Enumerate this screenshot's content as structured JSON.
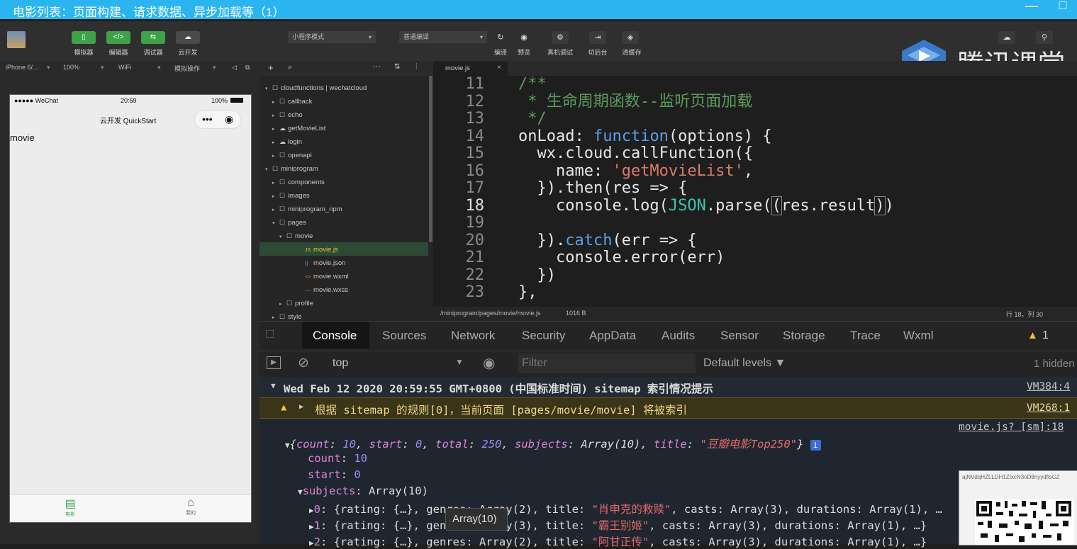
{
  "window": {
    "title": "电影列表：页面构建、请求数据、异步加载等（1）",
    "min_icon": "minimize-icon",
    "max_icon": "maximize-icon"
  },
  "watermark": {
    "text": "腾讯课堂"
  },
  "toolbar": {
    "left_buttons": [
      {
        "label": "模拟器",
        "icon": "phone-icon",
        "color": "#3ea24a"
      },
      {
        "label": "编辑器",
        "icon": "code-icon",
        "color": "#3ea24a"
      },
      {
        "label": "调试器",
        "icon": "debug-icon",
        "color": "#3ea24a"
      },
      {
        "label": "云开发",
        "icon": "cloud-icon",
        "color": "#4a4a4a"
      }
    ],
    "mode_select": "小程序模式",
    "compile_select": "普通编译",
    "right_buttons": [
      {
        "label": "编译",
        "icon": "refresh-icon"
      },
      {
        "label": "预览",
        "icon": "eye-icon"
      },
      {
        "label": "真机调试",
        "icon": "device-debug-icon"
      },
      {
        "label": "切后台",
        "icon": "background-icon"
      },
      {
        "label": "清缓存",
        "icon": "clear-cache-icon"
      }
    ]
  },
  "subbar": {
    "device": "iPhone 6/...",
    "zoom": "100%",
    "network": "WiFi",
    "sim_op": "模拟操作"
  },
  "phone": {
    "status_carrier": "●●●●● WeChat",
    "status_time": "20:59",
    "status_battery": "100%",
    "nav_title": "云开发 QuickStart",
    "body_text": "movie",
    "tabs": [
      {
        "label": "电影",
        "icon": "film-icon",
        "active": true
      },
      {
        "label": "我的",
        "icon": "home-icon",
        "active": false
      }
    ]
  },
  "tree": {
    "items": [
      {
        "label": "cloudfunctions | wechatcloud",
        "arrow": "▾",
        "icon": "folder",
        "depth": 0
      },
      {
        "label": "callback",
        "arrow": "▸",
        "icon": "folder",
        "depth": 1
      },
      {
        "label": "echo",
        "arrow": "▸",
        "icon": "folder",
        "depth": 1
      },
      {
        "label": "getMovieList",
        "arrow": "▸",
        "icon": "cloud",
        "depth": 1
      },
      {
        "label": "login",
        "arrow": "▸",
        "icon": "cloud",
        "depth": 1
      },
      {
        "label": "openapi",
        "arrow": "▸",
        "icon": "folder",
        "depth": 1
      },
      {
        "label": "miniprogram",
        "arrow": "▾",
        "icon": "folder",
        "depth": 0
      },
      {
        "label": "components",
        "arrow": "▸",
        "icon": "folder",
        "depth": 1
      },
      {
        "label": "images",
        "arrow": "▸",
        "icon": "folder",
        "depth": 1
      },
      {
        "label": "miniprogram_npm",
        "arrow": "▸",
        "icon": "folder",
        "depth": 1
      },
      {
        "label": "pages",
        "arrow": "▾",
        "icon": "folder",
        "depth": 1
      },
      {
        "label": "movie",
        "arrow": "▾",
        "icon": "folder",
        "depth": 2
      },
      {
        "label": "movie.js",
        "arrow": "",
        "icon": "js",
        "depth": 3,
        "selected": true
      },
      {
        "label": "movie.json",
        "arrow": "",
        "icon": "json",
        "depth": 3
      },
      {
        "label": "movie.wxml",
        "arrow": "",
        "icon": "wxml",
        "depth": 3
      },
      {
        "label": "movie.wxss",
        "arrow": "",
        "icon": "wxss",
        "depth": 3
      },
      {
        "label": "profile",
        "arrow": "▸",
        "icon": "folder",
        "depth": 2
      },
      {
        "label": "style",
        "arrow": "▸",
        "icon": "folder",
        "depth": 1
      }
    ]
  },
  "editor": {
    "tab": "movie.js",
    "line_numbers": [
      "11",
      "12",
      "13",
      "14",
      "15",
      "16",
      "17",
      "18",
      "19",
      "20",
      "21",
      "22",
      "23"
    ],
    "status_path": "/miniprogram/pages/movie/movie.js",
    "status_size": "1016 B",
    "status_pos": "行 18，列 30"
  },
  "devtools": {
    "tabs": [
      "Console",
      "Sources",
      "Network",
      "Security",
      "AppData",
      "Audits",
      "Sensor",
      "Storage",
      "Trace",
      "Wxml"
    ],
    "warn_count": "1",
    "context": "top",
    "filter_placeholder": "Filter",
    "levels": "Default levels ▼",
    "hidden": "1 hidden"
  },
  "console": {
    "group_title": "Wed Feb 12 2020 20:59:55 GMT+0800 (中国标准时间) sitemap 索引情况提示",
    "group_src": "VM384:4",
    "warn_text": "根据 sitemap 的规则[0]，当前页面 [pages/movie/movie] 将被索引",
    "warn_src": "VM268:1",
    "log_src": "movie.js? [sm]:18",
    "tooltip": "Array(10)",
    "qr_text": "ajNVdqHZLLDH1ZIxcN3oD8nyydflsCZ"
  }
}
